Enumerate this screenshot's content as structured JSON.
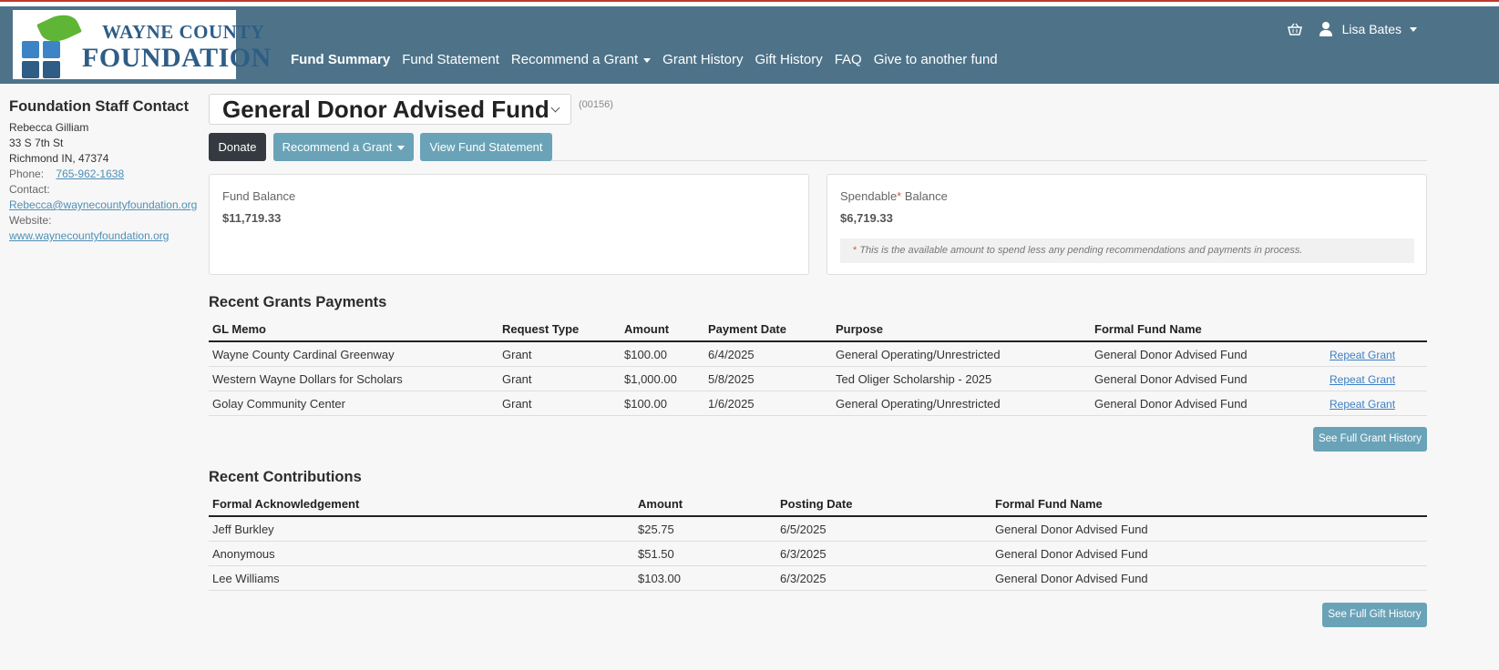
{
  "brand": {
    "logo_line1": "WAYNE COUNTY",
    "logo_line2": "FOUNDATION",
    "colors": {
      "navbar": "#4e7389",
      "logo_text": "#2e5d86",
      "leaf": "#5fb535",
      "squares": [
        "#3c84c6",
        "#2e5d86"
      ]
    }
  },
  "nav": {
    "items": [
      {
        "label": "Fund Summary",
        "active": true
      },
      {
        "label": "Fund Statement"
      },
      {
        "label": "Recommend a Grant",
        "dropdown": true
      },
      {
        "label": "Grant History"
      },
      {
        "label": "Gift History"
      },
      {
        "label": "FAQ"
      },
      {
        "label": "Give to another fund"
      }
    ],
    "user_name": "Lisa Bates",
    "icons": [
      "basket-icon",
      "user-icon",
      "caret-down-icon"
    ]
  },
  "sidebar": {
    "heading": "Foundation Staff Contact",
    "name": "Rebecca Gilliam",
    "address1": "33 S 7th St",
    "address2": "Richmond IN, 47374",
    "phone_label": "Phone:",
    "phone": "765-962-1638",
    "contact_label": "Contact:",
    "email": "Rebecca@waynecountyfoundation.org",
    "website_label": "Website:",
    "website": "www.waynecountyfoundation.org"
  },
  "fund": {
    "name": "General Donor Advised Fund",
    "number": "(00156)"
  },
  "actions": {
    "donate": "Donate",
    "recommend": "Recommend a Grant",
    "view_statement": "View Fund Statement"
  },
  "balances": {
    "fund_title": "Fund Balance",
    "fund_value": "$11,719.33",
    "spendable_title": "Spendable",
    "spendable_star": "*",
    "spendable_title_suffix": " Balance",
    "spendable_value": "$6,719.33",
    "spendable_note_star": "*",
    "spendable_note": " This is the available amount to spend less any pending recommendations and payments in process."
  },
  "grants": {
    "heading": "Recent Grants Payments",
    "columns": [
      "GL Memo",
      "Request Type",
      "Amount",
      "Payment Date",
      "Purpose",
      "Formal Fund Name",
      ""
    ],
    "rows": [
      {
        "memo": "Wayne County Cardinal Greenway",
        "type": "Grant",
        "amount": "$100.00",
        "date": "6/4/2025",
        "purpose": "General Operating/Unrestricted",
        "fund": "General Donor Advised Fund",
        "action": "Repeat Grant"
      },
      {
        "memo": "Western Wayne Dollars for Scholars",
        "type": "Grant",
        "amount": "$1,000.00",
        "date": "5/8/2025",
        "purpose": "Ted Oliger Scholarship - 2025",
        "fund": "General Donor Advised Fund",
        "action": "Repeat Grant"
      },
      {
        "memo": "Golay Community Center",
        "type": "Grant",
        "amount": "$100.00",
        "date": "1/6/2025",
        "purpose": "General Operating/Unrestricted",
        "fund": "General Donor Advised Fund",
        "action": "Repeat Grant"
      }
    ],
    "full_history_button": "See Full Grant History"
  },
  "contributions": {
    "heading": "Recent Contributions",
    "columns": [
      "Formal Acknowledgement",
      "Amount",
      "Posting Date",
      "Formal Fund Name"
    ],
    "rows": [
      {
        "ack": "Jeff Burkley",
        "amount": "$25.75",
        "date": "6/5/2025",
        "fund": "General Donor Advised Fund"
      },
      {
        "ack": "Anonymous",
        "amount": "$51.50",
        "date": "6/3/2025",
        "fund": "General Donor Advised Fund"
      },
      {
        "ack": "Lee Williams",
        "amount": "$103.00",
        "date": "6/3/2025",
        "fund": "General Donor Advised Fund"
      }
    ],
    "full_history_button": "See Full Gift History"
  }
}
